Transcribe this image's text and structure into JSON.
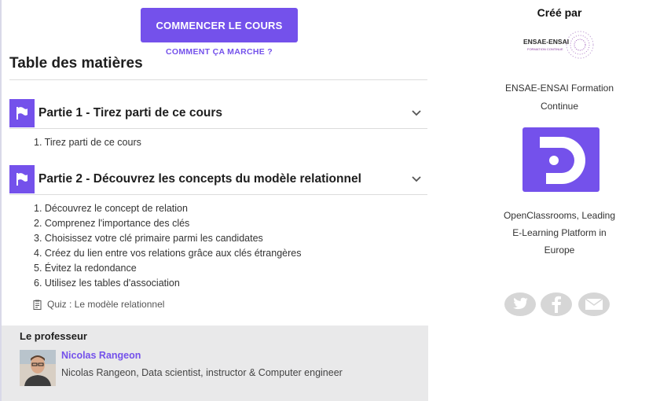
{
  "course": {
    "start_button": "COMMENCER LE COURS",
    "how_link": "COMMENT ÇA MARCHE ?"
  },
  "toc": {
    "title": "Table des matières",
    "parts": [
      {
        "title": "Partie 1 - Tirez parti de ce cours",
        "chapters": [
          "1. Tirez parti de ce cours"
        ]
      },
      {
        "title": "Partie 2 - Découvrez les concepts du modèle relationnel",
        "chapters": [
          "1. Découvrez le concept de relation",
          "2. Comprenez l'importance des clés",
          "3. Choisissez votre clé primaire parmi les candidates",
          "4. Créez du lien entre vos relations grâce aux clés étrangères",
          "5. Évitez la redondance",
          "6. Utilisez les tables d'association"
        ],
        "quiz": "Quiz : Le modèle relationnel"
      }
    ]
  },
  "professor": {
    "section_title": "Le professeur",
    "name": "Nicolas Rangeon",
    "description": "Nicolas Rangeon, Data scientist, instructor & Computer engineer"
  },
  "sidebar": {
    "created_by": "Créé par",
    "ensae_logo_text": "ENSAE-ENSAI",
    "ensae_logo_subtext": "FORMATION CONTINUE",
    "ensae_name_line1": "ENSAE-ENSAI Formation",
    "ensae_name_line2": "Continue",
    "oc_name_line1": "OpenClassrooms, Leading",
    "oc_name_line2": "E-Learning Platform in",
    "oc_name_line3": "Europe"
  },
  "colors": {
    "accent": "#7451eb",
    "professor_bg": "#e9e9ea",
    "social_bg": "#d6d6d6"
  },
  "icons": [
    "flag-icon",
    "chevron-down-icon",
    "quiz-icon",
    "twitter-icon",
    "facebook-icon",
    "email-icon"
  ]
}
